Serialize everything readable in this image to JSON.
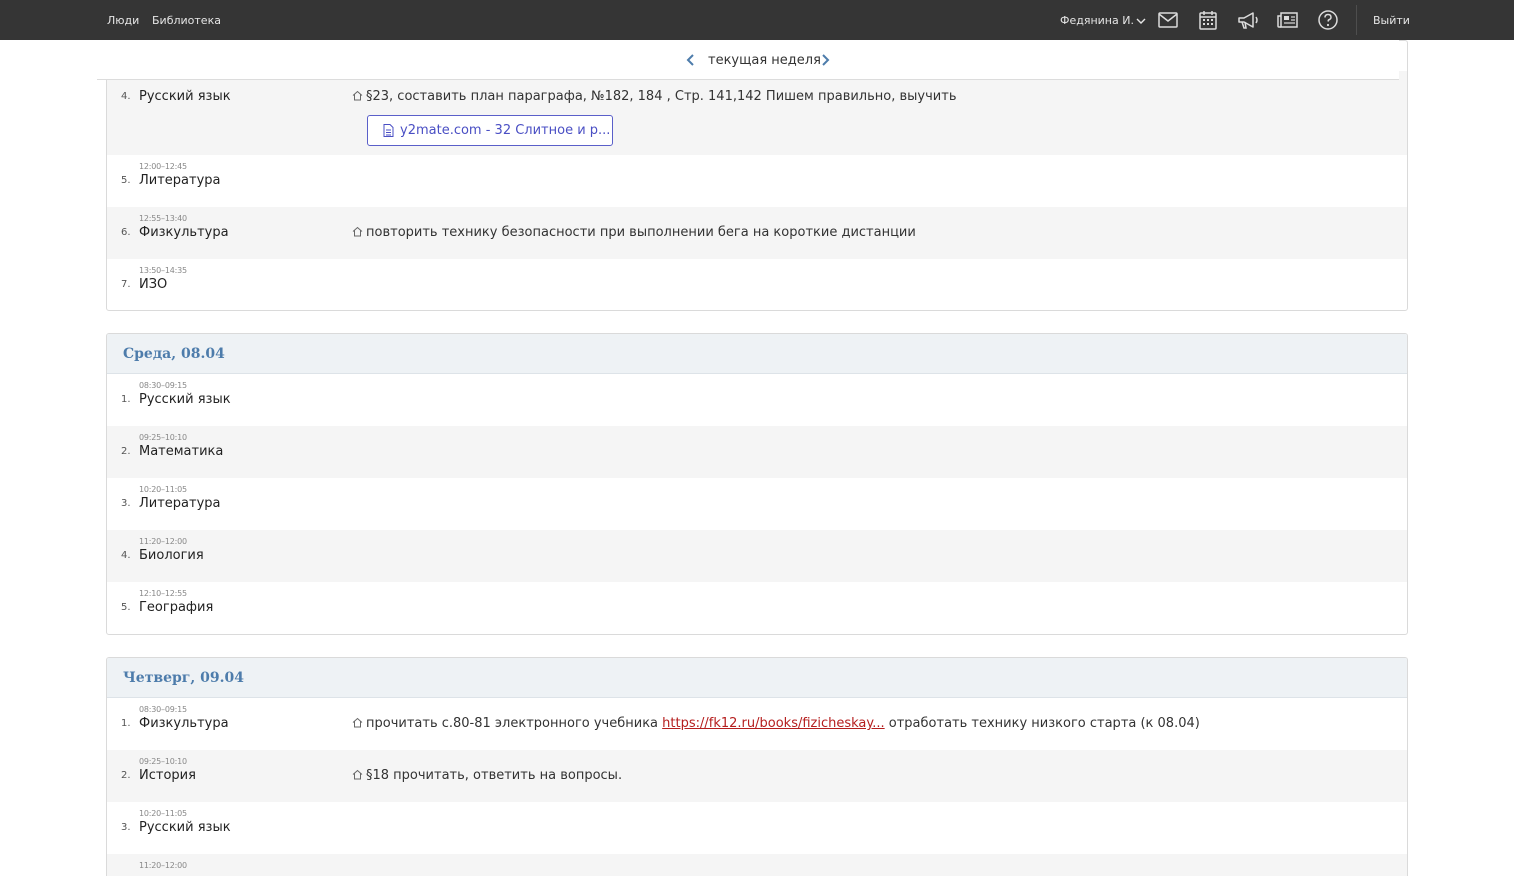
{
  "header": {
    "nav": [
      "Люди",
      "Библиотека"
    ],
    "user_name": "Федянина И.",
    "icons": [
      "mail-icon",
      "calendar-icon",
      "megaphone-icon",
      "newspaper-icon",
      "help-icon"
    ],
    "logout": "Выйти"
  },
  "week_nav": {
    "label": "текущая неделя"
  },
  "days": [
    {
      "title": "",
      "lessons": [
        {
          "num": "4.",
          "time": "",
          "subject": "Русский язык",
          "hw": "§23, составить план параграфа, №182, 184 , Стр. 141,142 Пишем правильно, выучить",
          "attachment": "y2mate.com - 32 Слитное и р..."
        },
        {
          "num": "5.",
          "time": "12:00–12:45",
          "subject": "Литература"
        },
        {
          "num": "6.",
          "time": "12:55–13:40",
          "subject": "Физкультура",
          "hw": "повторить технику безопасности при выполнении бега на короткие дистанции"
        },
        {
          "num": "7.",
          "time": "13:50–14:35",
          "subject": "ИЗО"
        }
      ]
    },
    {
      "title": "Среда, 08.04",
      "lessons": [
        {
          "num": "1.",
          "time": "08:30–09:15",
          "subject": "Русский язык"
        },
        {
          "num": "2.",
          "time": "09:25–10:10",
          "subject": "Математика"
        },
        {
          "num": "3.",
          "time": "10:20–11:05",
          "subject": "Литература"
        },
        {
          "num": "4.",
          "time": "11:20–12:00",
          "subject": "Биология"
        },
        {
          "num": "5.",
          "time": "12:10–12:55",
          "subject": "География"
        }
      ]
    },
    {
      "title": "Четверг, 09.04",
      "lessons": [
        {
          "num": "1.",
          "time": "08:30–09:15",
          "subject": "Физкультура",
          "hw_before": "прочитать с.80-81 электронного учебника",
          "hw_link": "https://fk12.ru/books/fizicheskay...",
          "hw_after": "отработать технику низкого старта (к 08.04)"
        },
        {
          "num": "2.",
          "time": "09:25–10:10",
          "subject": "История",
          "hw": "§18 прочитать, ответить на вопросы."
        },
        {
          "num": "3.",
          "time": "10:20–11:05",
          "subject": "Русский язык"
        },
        {
          "num": "",
          "time": "11:20–12:00",
          "subject": ""
        }
      ]
    }
  ],
  "colors": {
    "topbar": "#353535",
    "day_title": "#4d7cab",
    "link": "#b51e1e",
    "attachment": "#4a4fc4"
  }
}
